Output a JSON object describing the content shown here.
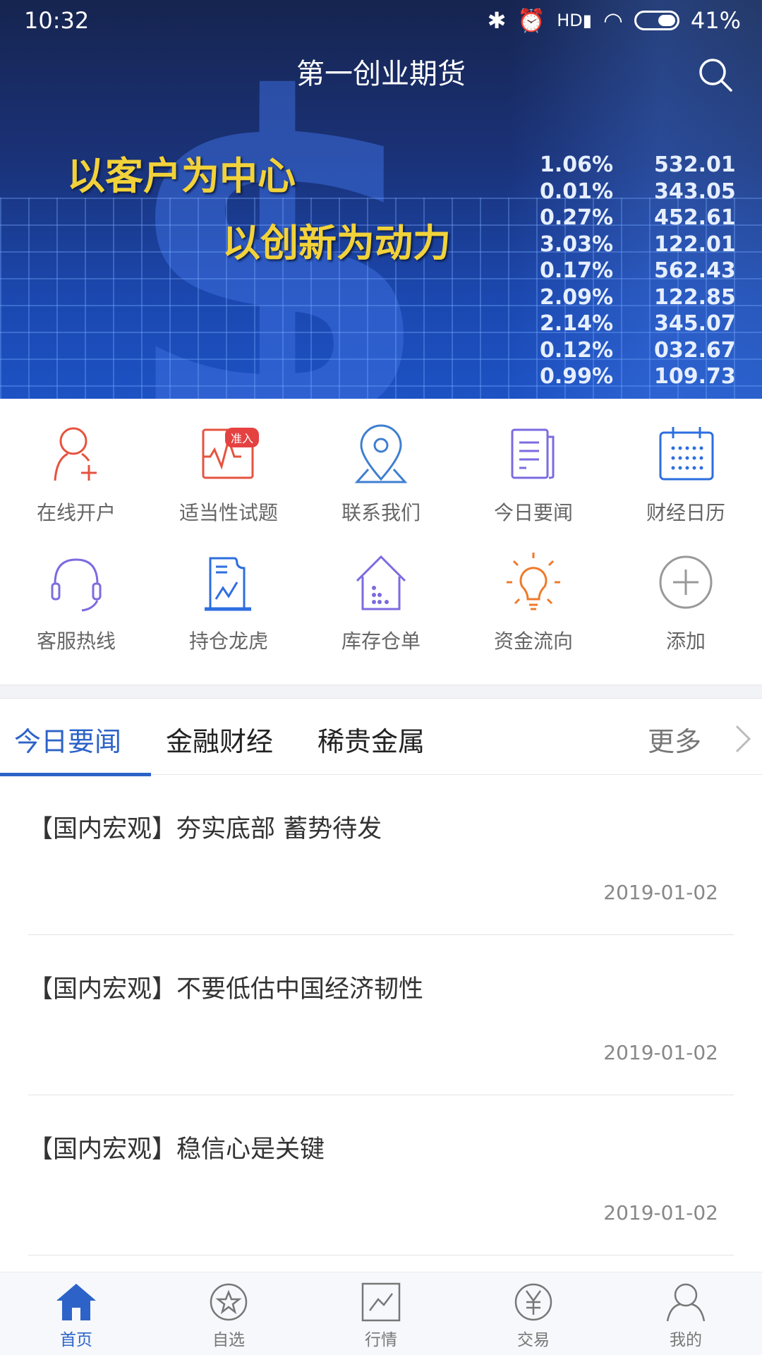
{
  "status_bar": {
    "time": "10:32",
    "battery": "41%"
  },
  "header": {
    "title": "第一创业期货",
    "search_icon": "search-icon"
  },
  "banner": {
    "slogan_1": "以客户为中心",
    "slogan_2": "以创新为动力",
    "ticker": [
      [
        "1.06%",
        "532.01"
      ],
      [
        "0.01%",
        "343.05"
      ],
      [
        "0.27%",
        "452.61"
      ],
      [
        "3.03%",
        "122.01"
      ],
      [
        "0.17%",
        "562.43"
      ],
      [
        "2.09%",
        "122.85"
      ],
      [
        "2.14%",
        "345.07"
      ],
      [
        "0.12%",
        "032.67"
      ],
      [
        "0.99%",
        "109.73"
      ]
    ]
  },
  "shortcuts": [
    {
      "label": "在线开户",
      "icon": "user-add-icon",
      "color": "#e5533f"
    },
    {
      "label": "适当性试题",
      "icon": "chart-monitor-icon",
      "color": "#e5533f",
      "badge": "准入"
    },
    {
      "label": "联系我们",
      "icon": "location-pin-icon",
      "color": "#3f7fd0"
    },
    {
      "label": "今日要闻",
      "icon": "newspaper-icon",
      "color": "#7b6be0"
    },
    {
      "label": "财经日历",
      "icon": "calendar-icon",
      "color": "#2d6ee0"
    },
    {
      "label": "客服热线",
      "icon": "headset-icon",
      "color": "#7b6be0"
    },
    {
      "label": "持仓龙虎",
      "icon": "report-chart-icon",
      "color": "#2d6ee0"
    },
    {
      "label": "库存仓单",
      "icon": "warehouse-icon",
      "color": "#7b6be0"
    },
    {
      "label": "资金流向",
      "icon": "lightbulb-icon",
      "color": "#ef7a2a"
    },
    {
      "label": "添加",
      "icon": "plus-circle-icon",
      "color": "#999999"
    }
  ],
  "tabs": {
    "items": [
      "今日要闻",
      "金融财经",
      "稀贵金属"
    ],
    "active": 0,
    "more": "更多"
  },
  "news": [
    {
      "title": "【国内宏观】夯实底部 蓄势待发",
      "date": "2019-01-02"
    },
    {
      "title": "【国内宏观】不要低估中国经济韧性",
      "date": "2019-01-02"
    },
    {
      "title": "【国内宏观】稳信心是关键",
      "date": "2019-01-02"
    }
  ],
  "bottom_nav": {
    "items": [
      {
        "label": "首页",
        "icon": "home-icon"
      },
      {
        "label": "自选",
        "icon": "star-circle-icon"
      },
      {
        "label": "行情",
        "icon": "chart-icon"
      },
      {
        "label": "交易",
        "icon": "yen-circle-icon"
      },
      {
        "label": "我的",
        "icon": "user-icon"
      }
    ],
    "active": 0
  },
  "colors": {
    "accent": "#2d63c8",
    "badge": "#e54141",
    "slogan": "#f2d23a"
  }
}
